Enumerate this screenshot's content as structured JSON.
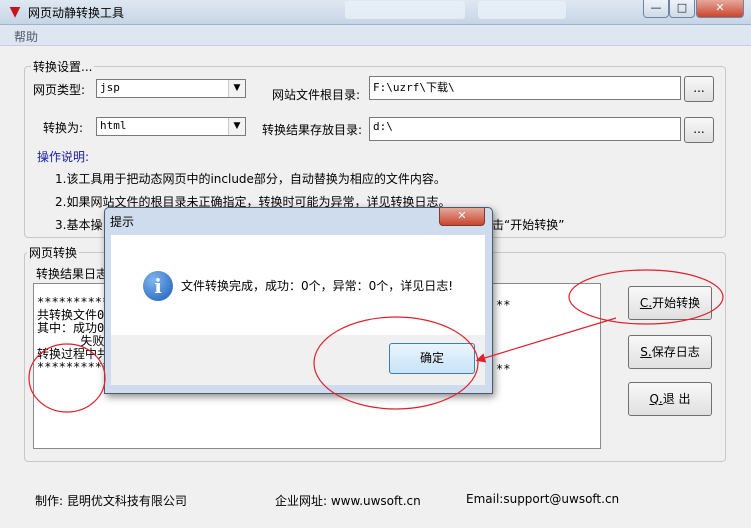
{
  "window": {
    "title": "网页动静转换工具",
    "min_glyph": "—",
    "max_glyph": "□",
    "close_glyph": "✕"
  },
  "menu": {
    "help": "帮助"
  },
  "settings": {
    "group_title": "转换设置...",
    "page_type_label": "网页类型:",
    "page_type_value": "jsp",
    "convert_to_label": "转换为:",
    "convert_to_value": "html",
    "root_dir_label": "网站文件根目录:",
    "root_dir_value": "F:\\uzrf\\下载\\",
    "output_dir_label": "转换结果存放目录:",
    "output_dir_value": "d:\\",
    "browse_label": "...",
    "instructions_title": "操作说明:",
    "instructions": [
      "1.该工具用于把动态网页中的include部分，自动替换为相应的文件内容。",
      "2.如果网站文件的根目录未正确指定，转换时可能为异常，详见转换日志。",
      "3.基本操"
    ],
    "instruction3_tail": "击“开始转换”"
  },
  "convert": {
    "group_title": "网页转换",
    "log_label": "转换结果日志",
    "log_text": "***********\n共转换文件0\n其中：成功0\n      失败0\n转换过程中共\n***********",
    "log_stars_right": "**",
    "start_key": "C.",
    "start_text": "开始转换",
    "save_key": "S.",
    "save_text": "保存日志",
    "exit_key": "Q.",
    "exit_text": "退  出"
  },
  "footer": {
    "maker": "制作: 昆明优文科技有限公司",
    "website": "企业网址: www.uwsoft.cn",
    "email": "Email:support@uwsoft.cn"
  },
  "dialog": {
    "title": "提示",
    "message": "文件转换完成，成功：0个，异常：0个，详见日志!",
    "ok_label": "确定",
    "icon": "information-icon"
  },
  "colors": {
    "annotation": "#e0202a",
    "instructions_title": "#1a1aa8"
  }
}
